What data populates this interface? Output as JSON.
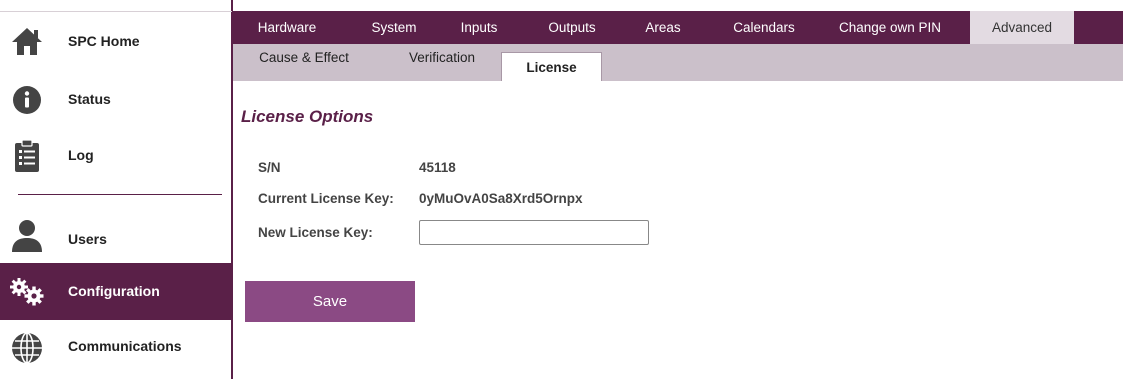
{
  "sidebar": {
    "items": [
      {
        "label": "SPC Home",
        "icon": "home-icon"
      },
      {
        "label": "Status",
        "icon": "info-icon"
      },
      {
        "label": "Log",
        "icon": "clipboard-list-icon"
      },
      {
        "label": "Users",
        "icon": "user-icon"
      },
      {
        "label": "Configuration",
        "icon": "gears-icon",
        "active": true
      },
      {
        "label": "Communications",
        "icon": "globe-icon"
      }
    ]
  },
  "tabs": [
    {
      "label": "Hardware"
    },
    {
      "label": "System"
    },
    {
      "label": "Inputs"
    },
    {
      "label": "Outputs"
    },
    {
      "label": "Areas"
    },
    {
      "label": "Calendars"
    },
    {
      "label": "Change own PIN"
    },
    {
      "label": "Advanced",
      "active": true
    }
  ],
  "subtabs": [
    {
      "label": "Cause & Effect"
    },
    {
      "label": "Verification"
    },
    {
      "label": "License",
      "active": true
    }
  ],
  "main": {
    "title": "License Options",
    "fields": {
      "sn_label": "S/N",
      "sn_value": "45118",
      "current_key_label": "Current License Key:",
      "current_key_value": "0yMuOvA0Sa8Xrd5Ornpx",
      "new_key_label": "New License Key:",
      "new_key_value": ""
    },
    "save_label": "Save"
  },
  "colors": {
    "brand": "#5a2048",
    "button": "#8b4a84",
    "subbar": "#cbc0ca"
  }
}
